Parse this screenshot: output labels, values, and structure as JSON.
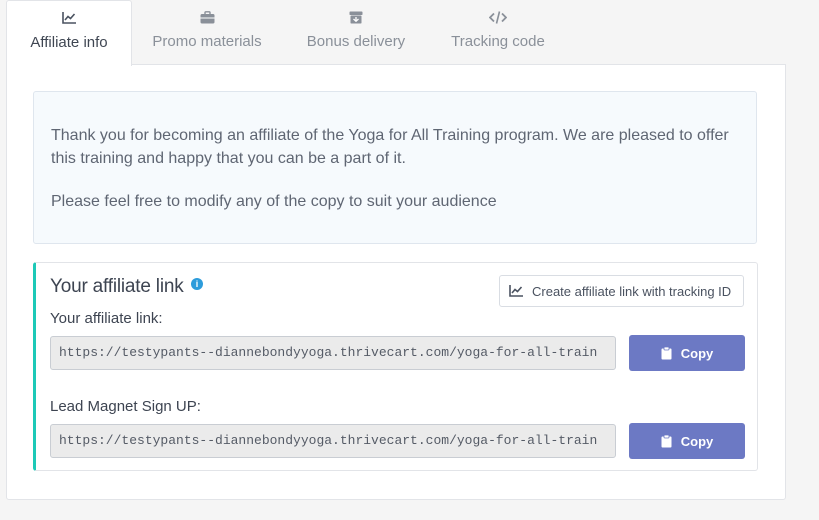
{
  "tabs": [
    {
      "label": "Affiliate info",
      "icon": "chart-icon",
      "active": true
    },
    {
      "label": "Promo materials",
      "icon": "briefcase-icon",
      "active": false
    },
    {
      "label": "Bonus delivery",
      "icon": "gift-box-icon",
      "active": false
    },
    {
      "label": "Tracking code",
      "icon": "code-icon",
      "active": false
    }
  ],
  "intro": {
    "paragraph1": "Thank you for becoming an affiliate of the Yoga for All Training program. We are pleased to offer this training and happy that you can be a part of it.",
    "paragraph2": "Please feel free to modify any of the copy to suit your audience"
  },
  "affiliate_card": {
    "title": "Your affiliate link",
    "info_icon": "i",
    "create_button": "Create affiliate link with tracking ID",
    "fields": [
      {
        "label": "Your affiliate link:",
        "value": "https://testypants--diannebondyyoga.thrivecart.com/yoga-for-all-train",
        "copy_label": "Copy"
      },
      {
        "label": "Lead Magnet Sign UP:",
        "value": "https://testypants--diannebondyyoga.thrivecart.com/yoga-for-all-train",
        "copy_label": "Copy"
      }
    ]
  },
  "colors": {
    "accent_border": "#1dc9b7",
    "copy_button": "#6c79c4",
    "info_icon": "#2d9cdb"
  }
}
